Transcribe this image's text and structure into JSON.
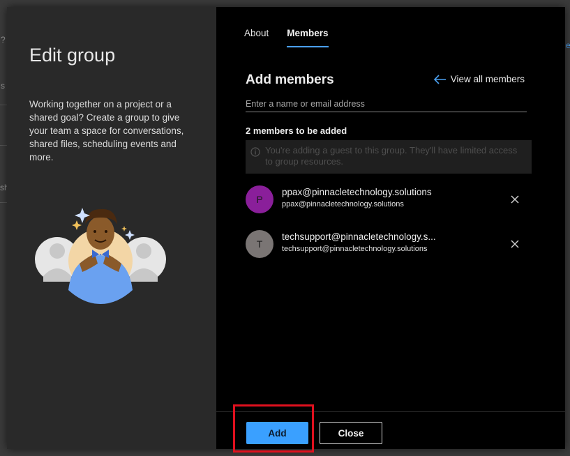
{
  "background": {
    "fragments": [
      "?",
      "s",
      "sh"
    ],
    "right_fragment": "e"
  },
  "dialog": {
    "title": "Edit group",
    "description": "Working together on a project or a shared goal? Create a group to give your team a space for conversations, shared files, scheduling events and more.",
    "illustration_icon": "people-group-illustration"
  },
  "tabs": [
    {
      "label": "About",
      "active": false
    },
    {
      "label": "Members",
      "active": true
    }
  ],
  "add_members": {
    "title": "Add members",
    "view_all_label": "View all members",
    "search_placeholder": "Enter a name or email address",
    "search_value": "",
    "count_label": "2 members to be added",
    "notice": "You're adding a guest to this group. They'll have limited access to group resources."
  },
  "members": [
    {
      "initial": "P",
      "name": "ppax@pinnacletechnology.solutions",
      "email": "ppax@pinnacletechnology.solutions",
      "avatar_color": "#8a1f9a"
    },
    {
      "initial": "T",
      "name": "techsupport@pinnacletechnology.s...",
      "email": "techsupport@pinnacletechnology.solutions",
      "avatar_color": "#7a7574"
    }
  ],
  "footer": {
    "add_label": "Add",
    "close_label": "Close"
  },
  "colors": {
    "accent": "#3aa0ff",
    "highlight": "#e0101e"
  }
}
